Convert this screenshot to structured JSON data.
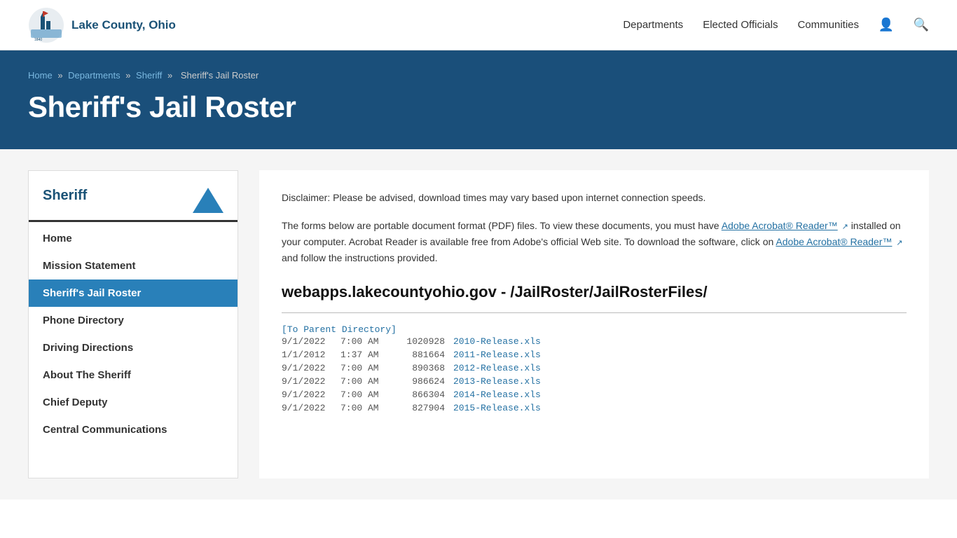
{
  "header": {
    "logo_text": "Lake County, Ohio",
    "nav": {
      "departments": "Departments",
      "elected_officials": "Elected Officials",
      "communities": "Communities"
    }
  },
  "breadcrumb": {
    "home": "Home",
    "departments": "Departments",
    "sheriff": "Sheriff",
    "current": "Sheriff's Jail Roster"
  },
  "hero": {
    "page_title": "Sheriff's Jail Roster"
  },
  "sidebar": {
    "title": "Sheriff",
    "items": [
      {
        "label": "Home",
        "active": false
      },
      {
        "label": "Mission Statement",
        "active": false
      },
      {
        "label": "Sheriff's Jail Roster",
        "active": true
      },
      {
        "label": "Phone Directory",
        "active": false
      },
      {
        "label": "Driving Directions",
        "active": false
      },
      {
        "label": "About The Sheriff",
        "active": false
      },
      {
        "label": "Chief Deputy",
        "active": false
      },
      {
        "label": "Central Communications",
        "active": false
      }
    ]
  },
  "content": {
    "disclaimer": "Disclaimer: Please be advised, download times may vary based upon internet connection speeds.",
    "pdf_note_1": "The forms below are portable document format (PDF) files. To view these documents, you must have",
    "adobe_link_1": "Adobe Acrobat® Reader™",
    "pdf_note_2": "installed on your computer. Acrobat Reader is available free from Adobe's official Web site. To download the software, click on",
    "adobe_link_2": "Adobe Acrobat® Reader™",
    "pdf_note_3": "and follow the instructions provided.",
    "file_server_heading": "webapps.lakecountyohio.gov - /JailRoster/JailRosterFiles/",
    "parent_dir_link": "[To Parent Directory]",
    "files": [
      {
        "date": "9/1/2022",
        "time": "7:00 AM",
        "size": "1020928",
        "name": "2010-Release.xls"
      },
      {
        "date": "1/1/2012",
        "time": "1:37 AM",
        "size": "881664",
        "name": "2011-Release.xls"
      },
      {
        "date": "9/1/2022",
        "time": "7:00 AM",
        "size": "890368",
        "name": "2012-Release.xls"
      },
      {
        "date": "9/1/2022",
        "time": "7:00 AM",
        "size": "986624",
        "name": "2013-Release.xls"
      },
      {
        "date": "9/1/2022",
        "time": "7:00 AM",
        "size": "866304",
        "name": "2014-Release.xls"
      },
      {
        "date": "9/1/2022",
        "time": "7:00 AM",
        "size": "827904",
        "name": "2015-Release.xls"
      }
    ]
  }
}
